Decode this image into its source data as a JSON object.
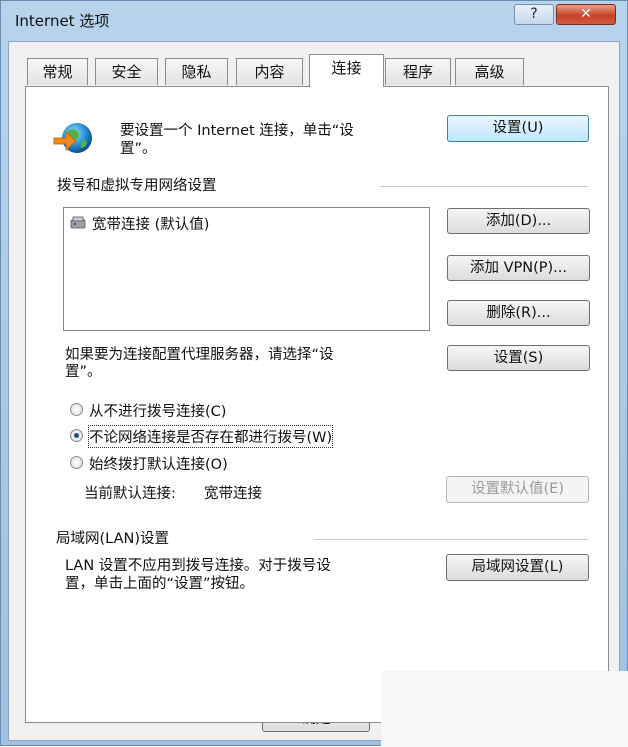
{
  "window": {
    "title": "Internet 选项",
    "help_glyph": "?",
    "close_glyph": "✕"
  },
  "tabs": [
    {
      "label": "常规"
    },
    {
      "label": "安全"
    },
    {
      "label": "隐私"
    },
    {
      "label": "内容"
    },
    {
      "label": "连接",
      "active": true
    },
    {
      "label": "程序"
    },
    {
      "label": "高级"
    }
  ],
  "setup": {
    "text_line1": "要设置一个 Internet 连接，单击“设",
    "text_line2": "置”。",
    "button": "设置(U)"
  },
  "dialup": {
    "section_title": "拨号和虚拟专用网络设置",
    "connections": [
      "宽带连接 (默认值)"
    ],
    "add_button": "添加(D)...",
    "add_vpn_button": "添加 VPN(P)...",
    "remove_button": "删除(R)...",
    "proxy_text_line1": "如果要为连接配置代理服务器，请选择“设",
    "proxy_text_line2": "置”。",
    "settings_button": "设置(S)",
    "options": [
      {
        "label": "从不进行拨号连接(C)",
        "checked": false
      },
      {
        "label": "不论网络连接是否存在都进行拨号(W)",
        "checked": true
      },
      {
        "label": "始终拨打默认连接(O)",
        "checked": false
      }
    ],
    "current_default_label": "当前默认连接:",
    "current_default_value": "宽带连接",
    "set_default_button": "设置默认值(E)"
  },
  "lan": {
    "section_title": "局域网(LAN)设置",
    "text_line1": "LAN 设置不应用到拨号连接。对于拨号设",
    "text_line2": "置，单击上面的“设置”按钮。",
    "button": "局域网设置(L)"
  },
  "footer": {
    "ok_button": "确定"
  }
}
